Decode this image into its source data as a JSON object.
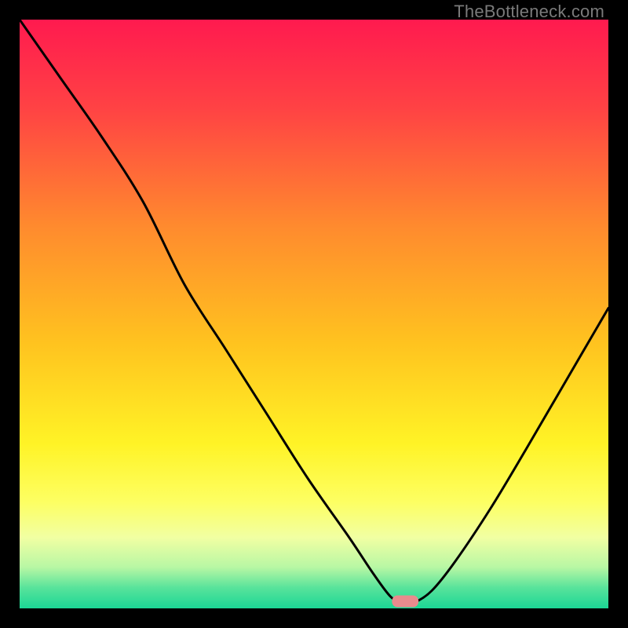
{
  "watermark": "TheBottleneck.com",
  "chart_data": {
    "type": "line",
    "title": "",
    "xlabel": "",
    "ylabel": "",
    "xlim": [
      0,
      100
    ],
    "ylim": [
      0,
      100
    ],
    "series": [
      {
        "name": "bottleneck-curve",
        "x": [
          0,
          7,
          14,
          21,
          28,
          35,
          42,
          49,
          56,
          60,
          63,
          65,
          67,
          70,
          74,
          80,
          86,
          93,
          100
        ],
        "y": [
          100,
          90,
          80,
          69,
          55,
          44,
          33,
          22,
          12,
          6,
          2,
          1,
          1,
          3,
          8,
          17,
          27,
          39,
          51
        ]
      }
    ],
    "marker": {
      "name": "optimal-point",
      "x": 65.5,
      "y": 1.2,
      "width_pct": 4.5,
      "height_pct": 2.0,
      "color": "#e98b8d"
    },
    "background_gradient": {
      "stops": [
        {
          "offset": 0.0,
          "color": "#ff1a4f"
        },
        {
          "offset": 0.15,
          "color": "#ff4244"
        },
        {
          "offset": 0.35,
          "color": "#ff8a2e"
        },
        {
          "offset": 0.55,
          "color": "#ffc31f"
        },
        {
          "offset": 0.72,
          "color": "#fff326"
        },
        {
          "offset": 0.82,
          "color": "#fdff63"
        },
        {
          "offset": 0.88,
          "color": "#f1ffa3"
        },
        {
          "offset": 0.93,
          "color": "#b8f7a4"
        },
        {
          "offset": 0.965,
          "color": "#58e39b"
        },
        {
          "offset": 1.0,
          "color": "#1bd795"
        }
      ]
    }
  }
}
